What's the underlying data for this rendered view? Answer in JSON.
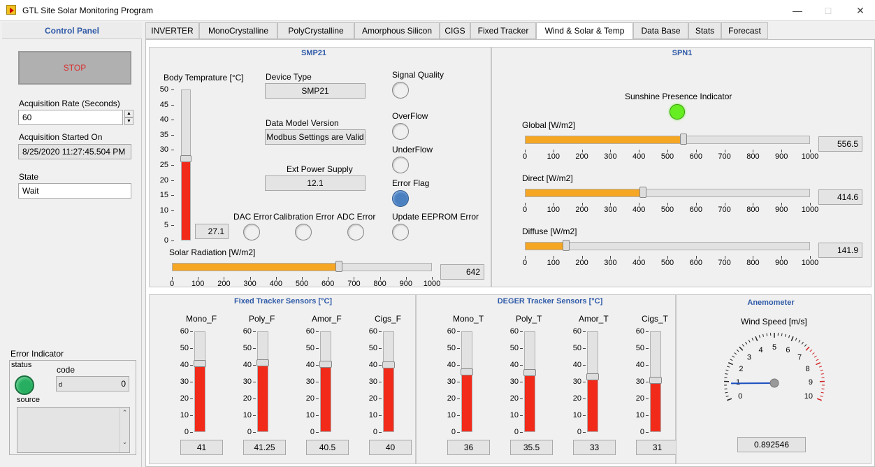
{
  "window": {
    "title": "GTL Site Solar Monitoring Program"
  },
  "control_panel": {
    "title": "Control Panel",
    "stop_label": "STOP",
    "acq_rate_label": "Acquisition Rate (Seconds)",
    "acq_rate_value": "60",
    "acq_started_label": "Acquisition Started On",
    "acq_started_value": "8/25/2020 11:27:45.504 PM",
    "state_label": "State",
    "state_value": "Wait",
    "error": {
      "title": "Error Indicator",
      "status_label": "status",
      "code_label": "code",
      "code_prefix": "d",
      "code_value": "0",
      "source_label": "source",
      "status_color": "#27ae60"
    }
  },
  "tabs": [
    "INVERTER",
    "MonoCrystalline",
    "PolyCrystalline",
    "Amorphous Silicon",
    "CIGS",
    "Fixed Tracker",
    "Wind & Solar & Temp",
    "Data Base",
    "Stats",
    "Forecast"
  ],
  "active_tab": "Wind & Solar & Temp",
  "smp21": {
    "title": "SMP21",
    "body_temp_label": "Body Temprature [°C]",
    "body_temp_value": "27.1",
    "body_temp_level": 27.1,
    "temp_scale": [
      "50",
      "45",
      "40",
      "35",
      "30",
      "25",
      "20",
      "15",
      "10",
      "5",
      "0"
    ],
    "device_type_label": "Device Type",
    "device_type_value": "SMP21",
    "data_model_label": "Data Model Version",
    "data_model_value": "Modbus Settings are Valid",
    "ext_power_label": "Ext Power Supply",
    "ext_power_value": "12.1",
    "signal_quality_label": "Signal Quality",
    "overflow_label": "OverFlow",
    "underflow_label": "UnderFlow",
    "error_flag_label": "Error Flag",
    "update_eeprom_label": "Update EEPROM Error",
    "dac_error_label": "DAC Error",
    "calibration_error_label": "Calibration Error",
    "adc_error_label": "ADC Error",
    "solar_radiation_label": "Solar Radiation [W/m2]",
    "solar_radiation_value": "642",
    "solar_radiation_level": 642
  },
  "spn1": {
    "title": "SPN1",
    "sunshine_label": "Sunshine Presence Indicator",
    "sunshine_color": "#66ee22",
    "global_label": "Global  [W/m2]",
    "global_value": "556.5",
    "global_level": 556.5,
    "direct_label": "Direct  [W/m2]",
    "direct_value": "414.6",
    "direct_level": 414.6,
    "diffuse_label": "Diffuse  [W/m2]",
    "diffuse_value": "141.9",
    "diffuse_level": 141.9
  },
  "h_scale": [
    "0",
    "100",
    "200",
    "300",
    "400",
    "500",
    "600",
    "700",
    "800",
    "900",
    "1000"
  ],
  "v_scale": [
    "60",
    "50",
    "40",
    "30",
    "20",
    "10",
    "0"
  ],
  "fixed_tracker": {
    "title": "Fixed Tracker Sensors [°C]",
    "sensors": [
      {
        "label": "Mono_F",
        "value": "41",
        "level": 41
      },
      {
        "label": "Poly_F",
        "value": "41.25",
        "level": 41.25
      },
      {
        "label": "Amor_F",
        "value": "40.5",
        "level": 40.5
      },
      {
        "label": "Cigs_F",
        "value": "40",
        "level": 40
      }
    ]
  },
  "deger_tracker": {
    "title": "DEGER Tracker Sensors [°C]",
    "sensors": [
      {
        "label": "Mono_T",
        "value": "36",
        "level": 36
      },
      {
        "label": "Poly_T",
        "value": "35.5",
        "level": 35.5
      },
      {
        "label": "Amor_T",
        "value": "33",
        "level": 33
      },
      {
        "label": "Cigs_T",
        "value": "31",
        "level": 31
      }
    ]
  },
  "anemometer": {
    "title": "Anemometer",
    "wind_label": "Wind Speed [m/s]",
    "wind_value": "0.892546",
    "wind_level": 0.892546,
    "scale": [
      "0",
      "1",
      "2",
      "3",
      "4",
      "5",
      "6",
      "7",
      "8",
      "9",
      "10"
    ]
  }
}
